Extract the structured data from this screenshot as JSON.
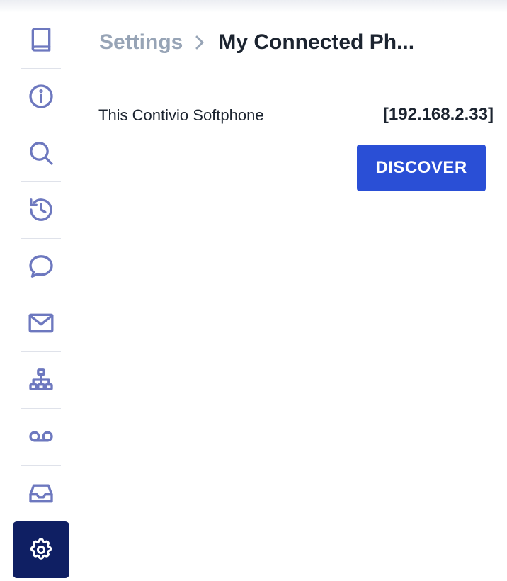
{
  "breadcrumb": {
    "root": "Settings",
    "current": "My Connected Ph..."
  },
  "sidebar": {
    "items": [
      {
        "name": "book-icon"
      },
      {
        "name": "info-icon"
      },
      {
        "name": "search-icon"
      },
      {
        "name": "history-icon"
      },
      {
        "name": "chat-bubble-icon"
      },
      {
        "name": "mail-icon"
      },
      {
        "name": "org-chart-icon"
      },
      {
        "name": "voicemail-icon"
      },
      {
        "name": "inbox-icon"
      },
      {
        "name": "gear-icon",
        "active": true
      }
    ]
  },
  "device": {
    "label": "This Contivio Softphone",
    "ip": "[192.168.2.33]"
  },
  "actions": {
    "discover_label": "DISCOVER"
  },
  "colors": {
    "accent": "#2a4fd6",
    "active_nav": "#0f1f63",
    "icon": "#6d78bf",
    "breadcrumb_muted": "#97a4b6",
    "text": "#1c2430"
  }
}
